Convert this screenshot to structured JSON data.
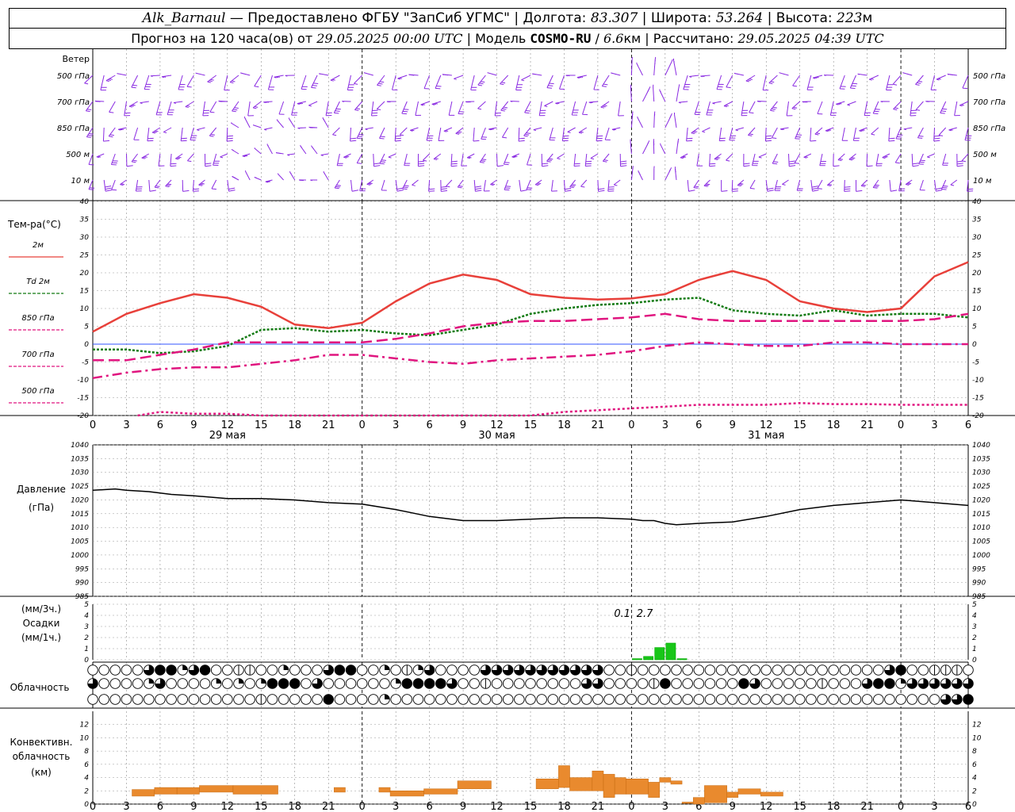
{
  "header": {
    "station": "Alk_Barnaul",
    "provider": "— Предоставлено ФГБУ \"ЗапСиб УГМС\"",
    "lon_label": "Долгота:",
    "lon": "83.307",
    "lat_label": "Широта:",
    "lat": "53.264",
    "alt_label": "Высота:",
    "alt": "223",
    "alt_unit": "м",
    "forecast_prefix": "Прогноз на 120 часа(ов) от",
    "forecast_from": "29.05.2025 00:00 UTC",
    "model_label": "Модель",
    "model": "COSMO-RU",
    "resolution": "6.6",
    "res_unit": "км",
    "calc_label": "Рассчитано:",
    "calc_time": "29.05.2025 04:39 UTC"
  },
  "colors": {
    "wind": "#8a2be2",
    "t2m": "#e8403a",
    "td2m": "#117a11",
    "t850": "#e0157f",
    "t700": "#e0157f",
    "t500": "#e0157f",
    "precip": "#18c618",
    "conv": "#e98a2e",
    "zero_line": "#3355ff"
  },
  "hour_ticks": [
    "0",
    "3",
    "6",
    "9",
    "12",
    "15",
    "18",
    "21",
    "0",
    "3",
    "6",
    "9",
    "12",
    "15",
    "18",
    "21",
    "0",
    "3",
    "6",
    "9",
    "12",
    "15",
    "18",
    "21",
    "0",
    "3",
    "6"
  ],
  "dates": [
    "29 мая",
    "30 мая",
    "31 мая"
  ],
  "wind_panel": {
    "title": "Ветер",
    "levels": [
      "500 гПа",
      "700 гПа",
      "850 гПа",
      "500 м",
      "10  м"
    ]
  },
  "chart_data": [
    {
      "type": "line",
      "title": "Тем-ра(°C)",
      "x_unit": "hours since 29.05.2025 00:00 UTC",
      "ylim": [
        -20,
        40
      ],
      "yticks": [
        "40",
        "35",
        "30",
        "25",
        "20",
        "15",
        "10",
        "5",
        "0",
        "-5",
        "-10",
        "-15",
        "-20"
      ],
      "series": [
        {
          "name": "2м",
          "x": [
            0,
            3,
            6,
            9,
            12,
            15,
            18,
            21,
            24,
            27,
            30,
            33,
            36,
            39,
            42,
            45,
            48,
            51,
            54,
            57,
            60,
            63,
            66,
            69,
            72,
            75,
            78
          ],
          "values": [
            3.5,
            8.5,
            11.5,
            14.0,
            13.0,
            10.5,
            5.5,
            4.5,
            6.0,
            12.0,
            17.0,
            19.5,
            18.0,
            14.0,
            13.0,
            12.5,
            12.8,
            14.0,
            18.0,
            20.5,
            18.0,
            12.0,
            10.0,
            9.0,
            10.0,
            19.0,
            23.0
          ]
        },
        {
          "name": "Td 2м",
          "x": [
            0,
            3,
            6,
            9,
            12,
            15,
            18,
            21,
            24,
            27,
            30,
            33,
            36,
            39,
            42,
            45,
            48,
            51,
            54,
            57,
            60,
            63,
            66,
            69,
            72,
            75,
            78
          ],
          "values": [
            -1.5,
            -1.5,
            -2.5,
            -2.0,
            -0.5,
            4.0,
            4.5,
            3.5,
            4.0,
            3.0,
            2.5,
            4.0,
            5.5,
            8.5,
            10.0,
            11.0,
            11.5,
            12.5,
            13.0,
            9.5,
            8.5,
            8.0,
            9.5,
            8.0,
            8.5,
            8.5,
            7.5
          ]
        },
        {
          "name": "850 гПа",
          "x": [
            0,
            3,
            6,
            9,
            12,
            15,
            18,
            21,
            24,
            27,
            30,
            33,
            36,
            39,
            42,
            45,
            48,
            51,
            54,
            57,
            60,
            63,
            66,
            69,
            72,
            75,
            78
          ],
          "values": [
            -4.5,
            -4.5,
            -3.0,
            -1.5,
            0.5,
            0.5,
            0.5,
            0.5,
            0.5,
            1.5,
            3.0,
            5.0,
            6.0,
            6.5,
            6.5,
            7.0,
            7.5,
            8.5,
            7.0,
            6.5,
            6.5,
            6.5,
            6.5,
            6.5,
            6.5,
            7.0,
            8.5
          ]
        },
        {
          "name": "700 гПа",
          "x": [
            0,
            3,
            6,
            9,
            12,
            15,
            18,
            21,
            24,
            27,
            30,
            33,
            36,
            39,
            42,
            45,
            48,
            51,
            54,
            57,
            60,
            63,
            66,
            69,
            72,
            75,
            78
          ],
          "values": [
            -9.5,
            -8.0,
            -7.0,
            -6.5,
            -6.5,
            -5.5,
            -4.5,
            -3.0,
            -3.0,
            -4.0,
            -5.0,
            -5.5,
            -4.5,
            -4.0,
            -3.5,
            -3.0,
            -2.0,
            -0.5,
            0.5,
            0.0,
            -0.5,
            -0.5,
            0.5,
            0.5,
            0.0,
            0.0,
            0.0
          ]
        },
        {
          "name": "500 гПа",
          "x": [
            4,
            6,
            9,
            12,
            15,
            39,
            42,
            45,
            48,
            51,
            54,
            57,
            60,
            63,
            66,
            69,
            72,
            75,
            78
          ],
          "values": [
            -20.0,
            -19.0,
            -19.5,
            -19.5,
            -20.0,
            -20.0,
            -19.0,
            -18.5,
            -18.0,
            -17.5,
            -17.0,
            -17.0,
            -17.0,
            -16.5,
            -16.8,
            -16.8,
            -17.0,
            -17.0,
            -17.0
          ]
        }
      ]
    },
    {
      "type": "line",
      "title": "Давление",
      "unit": "(гПа)",
      "ylim": [
        985,
        1040
      ],
      "yticks": [
        "1040",
        "1035",
        "1030",
        "1025",
        "1020",
        "1015",
        "1010",
        "1005",
        "1000",
        "995",
        "990",
        "985"
      ],
      "series": [
        {
          "name": "Давление",
          "x": [
            0,
            2,
            3,
            5,
            7,
            9,
            12,
            15,
            18,
            21,
            24,
            27,
            30,
            33,
            36,
            39,
            42,
            45,
            48,
            49,
            50,
            51,
            52,
            54,
            57,
            60,
            63,
            66,
            69,
            72,
            75,
            78
          ],
          "values": [
            1023.5,
            1024.0,
            1023.5,
            1023.0,
            1022.0,
            1021.5,
            1020.5,
            1020.5,
            1020.0,
            1019.0,
            1018.5,
            1016.5,
            1014.0,
            1012.5,
            1012.5,
            1013.0,
            1013.5,
            1013.5,
            1013.0,
            1012.5,
            1012.5,
            1011.5,
            1011.0,
            1011.5,
            1012.0,
            1014.0,
            1016.5,
            1018.0,
            1019.0,
            1020.0,
            1019.0,
            1018.0
          ]
        }
      ]
    },
    {
      "type": "bar",
      "title": "Осадки",
      "unit_3h": "(мм/3ч.)",
      "unit_1h": "(мм/1ч.)",
      "ylim": [
        0,
        5
      ],
      "yticks": [
        "5",
        "4",
        "3",
        "2",
        "1",
        "0"
      ],
      "x": [
        48,
        49,
        50,
        51,
        52
      ],
      "values": [
        0.1,
        0.3,
        1.1,
        1.5,
        0.1
      ],
      "annotations": [
        "0.1",
        "2.7"
      ],
      "annotation_x": [
        48,
        50
      ]
    },
    {
      "type": "table",
      "title": "Облачность",
      "x_step_hours": 1,
      "rows": [
        "0000034423400110020003440020123000033333333333001000000000000000000000034001110333333210110230000000000000000000000000000000000",
        "3000023000020202444030000002444430010000000033000014000000430000010003442333333333333440000000000000000000000000000000000",
        "0000000000000001000004000020000000000000000000000000000000000000000000000000334443331144444444000010000000000000000000000000"
      ]
    },
    {
      "type": "bar",
      "title": "Конвективн. облачность",
      "unit": "(км)",
      "ylim": [
        0,
        14
      ],
      "yticks": [
        "12",
        "10",
        "8",
        "6",
        "4",
        "2",
        "0"
      ],
      "bars": [
        {
          "from": 3.5,
          "to": 5.5,
          "bottom": 1.2,
          "top": 2.2
        },
        {
          "from": 5.5,
          "to": 7.5,
          "bottom": 1.5,
          "top": 2.5
        },
        {
          "from": 7.5,
          "to": 9.5,
          "bottom": 1.5,
          "top": 2.5
        },
        {
          "from": 9.5,
          "to": 12.5,
          "bottom": 1.8,
          "top": 2.8
        },
        {
          "from": 12.5,
          "to": 16.5,
          "bottom": 1.5,
          "top": 2.8
        },
        {
          "from": 21.5,
          "to": 22.5,
          "bottom": 1.8,
          "top": 2.5
        },
        {
          "from": 25.5,
          "to": 26.5,
          "bottom": 1.8,
          "top": 2.5
        },
        {
          "from": 26.5,
          "to": 29.5,
          "bottom": 1.2,
          "top": 2.0
        },
        {
          "from": 29.5,
          "to": 32.5,
          "bottom": 1.5,
          "top": 2.3
        },
        {
          "from": 32.5,
          "to": 35.5,
          "bottom": 2.3,
          "top": 3.5
        },
        {
          "from": 39.5,
          "to": 41.5,
          "bottom": 2.3,
          "top": 3.8
        },
        {
          "from": 41.5,
          "to": 42.5,
          "bottom": 2.5,
          "top": 5.8
        },
        {
          "from": 42.5,
          "to": 44.5,
          "bottom": 2.0,
          "top": 4.0
        },
        {
          "from": 44.5,
          "to": 45.5,
          "bottom": 2.0,
          "top": 5.0
        },
        {
          "from": 45.5,
          "to": 46.5,
          "bottom": 1.0,
          "top": 4.5
        },
        {
          "from": 46.5,
          "to": 47.5,
          "bottom": 1.5,
          "top": 4.0
        },
        {
          "from": 47.5,
          "to": 49.5,
          "bottom": 1.5,
          "top": 3.8
        },
        {
          "from": 49.5,
          "to": 50.5,
          "bottom": 1.0,
          "top": 3.3
        },
        {
          "from": 50.5,
          "to": 51.5,
          "bottom": 3.3,
          "top": 4.0
        },
        {
          "from": 51.5,
          "to": 52.5,
          "bottom": 3.0,
          "top": 3.5
        },
        {
          "from": 52.5,
          "to": 53.5,
          "bottom": 0.1,
          "top": 0.3
        },
        {
          "from": 53.5,
          "to": 54.5,
          "bottom": 0.0,
          "top": 1.0
        },
        {
          "from": 54.5,
          "to": 56.5,
          "bottom": 0.2,
          "top": 2.8
        },
        {
          "from": 56.5,
          "to": 57.5,
          "bottom": 1.0,
          "top": 1.8
        },
        {
          "from": 57.5,
          "to": 59.5,
          "bottom": 1.5,
          "top": 2.3
        },
        {
          "from": 59.5,
          "to": 61.5,
          "bottom": 1.2,
          "top": 1.8
        }
      ]
    }
  ]
}
